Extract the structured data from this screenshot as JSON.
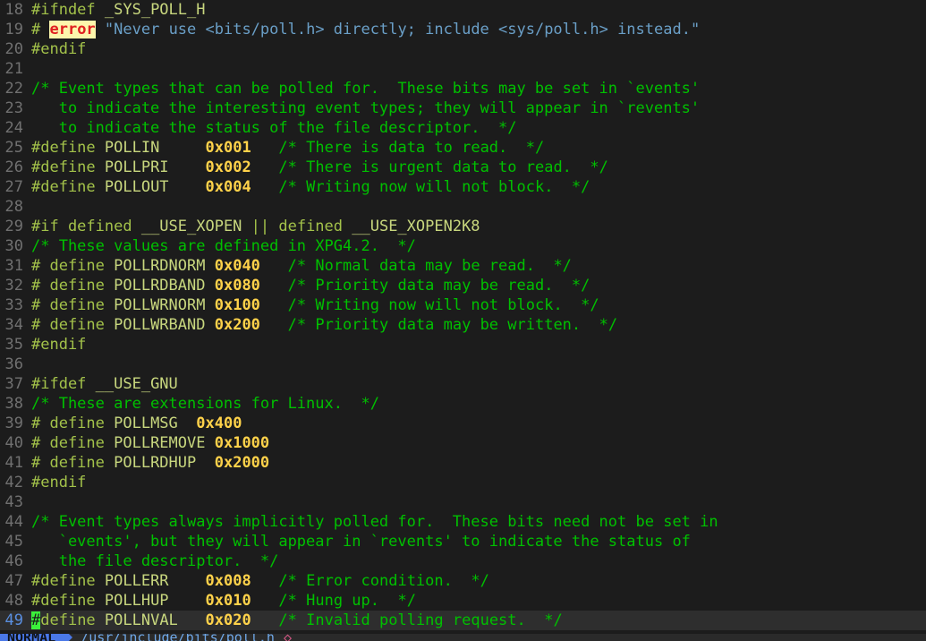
{
  "app": {
    "name": "vim-editor",
    "background": "#1c1c1c",
    "current_line": 49
  },
  "colors": {
    "background": "#1c1c1c",
    "current_line_background": "#2e2e2e",
    "line_number": "#707070",
    "current_line_number": "#5a8fe0",
    "preprocessor": "#a3c24a",
    "identifier": "#c8d77e",
    "number": "#ffd24a",
    "comment": "#00c000",
    "string": "#6a9fc7",
    "error_fg": "#e02020",
    "error_bg": "#fdf6ac",
    "cursor": "#3bf03b",
    "status_mode_bg": "#4a78e8",
    "status_file_fg": "#6fa8e8"
  },
  "statusline": {
    "mode": "NORMAL",
    "file": "/usr/include/bits/poll.h",
    "modified": "◇"
  },
  "lines": [
    {
      "num": "18",
      "current": false,
      "tokens": [
        {
          "t": "pre",
          "s": "#ifndef "
        },
        {
          "t": "ident",
          "s": "_SYS_POLL_H"
        }
      ]
    },
    {
      "num": "19",
      "current": false,
      "tokens": [
        {
          "t": "pre",
          "s": "# "
        },
        {
          "t": "err",
          "s": "error"
        },
        {
          "t": "plain",
          "s": " "
        },
        {
          "t": "str",
          "s": "\"Never use <bits/poll.h> directly; include <sys/poll.h> instead.\""
        }
      ]
    },
    {
      "num": "20",
      "current": false,
      "tokens": [
        {
          "t": "pre",
          "s": "#endif"
        }
      ]
    },
    {
      "num": "21",
      "current": false,
      "tokens": []
    },
    {
      "num": "22",
      "current": false,
      "tokens": [
        {
          "t": "cmt",
          "s": "/* Event types that can be polled for.  These bits may be set in `events'"
        }
      ]
    },
    {
      "num": "23",
      "current": false,
      "tokens": [
        {
          "t": "cmt",
          "s": "   to indicate the interesting event types; they will appear in `revents'"
        }
      ]
    },
    {
      "num": "24",
      "current": false,
      "tokens": [
        {
          "t": "cmt",
          "s": "   to indicate the status of the file descriptor.  */"
        }
      ]
    },
    {
      "num": "25",
      "current": false,
      "tokens": [
        {
          "t": "pre",
          "s": "#define "
        },
        {
          "t": "ident",
          "s": "POLLIN"
        },
        {
          "t": "plain",
          "s": "     "
        },
        {
          "t": "num",
          "s": "0x001"
        },
        {
          "t": "plain",
          "s": "   "
        },
        {
          "t": "cmt",
          "s": "/* There is data to read.  */"
        }
      ]
    },
    {
      "num": "26",
      "current": false,
      "tokens": [
        {
          "t": "pre",
          "s": "#define "
        },
        {
          "t": "ident",
          "s": "POLLPRI"
        },
        {
          "t": "plain",
          "s": "    "
        },
        {
          "t": "num",
          "s": "0x002"
        },
        {
          "t": "plain",
          "s": "   "
        },
        {
          "t": "cmt",
          "s": "/* There is urgent data to read.  */"
        }
      ]
    },
    {
      "num": "27",
      "current": false,
      "tokens": [
        {
          "t": "pre",
          "s": "#define "
        },
        {
          "t": "ident",
          "s": "POLLOUT"
        },
        {
          "t": "plain",
          "s": "    "
        },
        {
          "t": "num",
          "s": "0x004"
        },
        {
          "t": "plain",
          "s": "   "
        },
        {
          "t": "cmt",
          "s": "/* Writing now will not block.  */"
        }
      ]
    },
    {
      "num": "28",
      "current": false,
      "tokens": []
    },
    {
      "num": "29",
      "current": false,
      "tokens": [
        {
          "t": "pre",
          "s": "#if defined "
        },
        {
          "t": "ident",
          "s": "__USE_XOPEN"
        },
        {
          "t": "pre",
          "s": " || defined "
        },
        {
          "t": "ident",
          "s": "__USE_XOPEN2K8"
        }
      ]
    },
    {
      "num": "30",
      "current": false,
      "tokens": [
        {
          "t": "cmt",
          "s": "/* These values are defined in XPG4.2.  */"
        }
      ]
    },
    {
      "num": "31",
      "current": false,
      "tokens": [
        {
          "t": "pre",
          "s": "# define "
        },
        {
          "t": "ident",
          "s": "POLLRDNORM"
        },
        {
          "t": "plain",
          "s": " "
        },
        {
          "t": "num",
          "s": "0x040"
        },
        {
          "t": "plain",
          "s": "   "
        },
        {
          "t": "cmt",
          "s": "/* Normal data may be read.  */"
        }
      ]
    },
    {
      "num": "32",
      "current": false,
      "tokens": [
        {
          "t": "pre",
          "s": "# define "
        },
        {
          "t": "ident",
          "s": "POLLRDBAND"
        },
        {
          "t": "plain",
          "s": " "
        },
        {
          "t": "num",
          "s": "0x080"
        },
        {
          "t": "plain",
          "s": "   "
        },
        {
          "t": "cmt",
          "s": "/* Priority data may be read.  */"
        }
      ]
    },
    {
      "num": "33",
      "current": false,
      "tokens": [
        {
          "t": "pre",
          "s": "# define "
        },
        {
          "t": "ident",
          "s": "POLLWRNORM"
        },
        {
          "t": "plain",
          "s": " "
        },
        {
          "t": "num",
          "s": "0x100"
        },
        {
          "t": "plain",
          "s": "   "
        },
        {
          "t": "cmt",
          "s": "/* Writing now will not block.  */"
        }
      ]
    },
    {
      "num": "34",
      "current": false,
      "tokens": [
        {
          "t": "pre",
          "s": "# define "
        },
        {
          "t": "ident",
          "s": "POLLWRBAND"
        },
        {
          "t": "plain",
          "s": " "
        },
        {
          "t": "num",
          "s": "0x200"
        },
        {
          "t": "plain",
          "s": "   "
        },
        {
          "t": "cmt",
          "s": "/* Priority data may be written.  */"
        }
      ]
    },
    {
      "num": "35",
      "current": false,
      "tokens": [
        {
          "t": "pre",
          "s": "#endif"
        }
      ]
    },
    {
      "num": "36",
      "current": false,
      "tokens": []
    },
    {
      "num": "37",
      "current": false,
      "tokens": [
        {
          "t": "pre",
          "s": "#ifdef "
        },
        {
          "t": "ident",
          "s": "__USE_GNU"
        }
      ]
    },
    {
      "num": "38",
      "current": false,
      "tokens": [
        {
          "t": "cmt",
          "s": "/* These are extensions for Linux.  */"
        }
      ]
    },
    {
      "num": "39",
      "current": false,
      "tokens": [
        {
          "t": "pre",
          "s": "# define "
        },
        {
          "t": "ident",
          "s": "POLLMSG"
        },
        {
          "t": "plain",
          "s": "  "
        },
        {
          "t": "num",
          "s": "0x400"
        }
      ]
    },
    {
      "num": "40",
      "current": false,
      "tokens": [
        {
          "t": "pre",
          "s": "# define "
        },
        {
          "t": "ident",
          "s": "POLLREMOVE"
        },
        {
          "t": "plain",
          "s": " "
        },
        {
          "t": "num",
          "s": "0x1000"
        }
      ]
    },
    {
      "num": "41",
      "current": false,
      "tokens": [
        {
          "t": "pre",
          "s": "# define "
        },
        {
          "t": "ident",
          "s": "POLLRDHUP"
        },
        {
          "t": "plain",
          "s": "  "
        },
        {
          "t": "num",
          "s": "0x2000"
        }
      ]
    },
    {
      "num": "42",
      "current": false,
      "tokens": [
        {
          "t": "pre",
          "s": "#endif"
        }
      ]
    },
    {
      "num": "43",
      "current": false,
      "tokens": []
    },
    {
      "num": "44",
      "current": false,
      "tokens": [
        {
          "t": "cmt",
          "s": "/* Event types always implicitly polled for.  These bits need not be set in"
        }
      ]
    },
    {
      "num": "45",
      "current": false,
      "tokens": [
        {
          "t": "cmt",
          "s": "   `events', but they will appear in `revents' to indicate the status of"
        }
      ]
    },
    {
      "num": "46",
      "current": false,
      "tokens": [
        {
          "t": "cmt",
          "s": "   the file descriptor.  */"
        }
      ]
    },
    {
      "num": "47",
      "current": false,
      "tokens": [
        {
          "t": "pre",
          "s": "#define "
        },
        {
          "t": "ident",
          "s": "POLLERR"
        },
        {
          "t": "plain",
          "s": "    "
        },
        {
          "t": "num",
          "s": "0x008"
        },
        {
          "t": "plain",
          "s": "   "
        },
        {
          "t": "cmt",
          "s": "/* Error condition.  */"
        }
      ]
    },
    {
      "num": "48",
      "current": false,
      "tokens": [
        {
          "t": "pre",
          "s": "#define "
        },
        {
          "t": "ident",
          "s": "POLLHUP"
        },
        {
          "t": "plain",
          "s": "    "
        },
        {
          "t": "num",
          "s": "0x010"
        },
        {
          "t": "plain",
          "s": "   "
        },
        {
          "t": "cmt",
          "s": "/* Hung up.  */"
        }
      ]
    },
    {
      "num": "49",
      "current": true,
      "tokens": [
        {
          "t": "cursor",
          "s": "#"
        },
        {
          "t": "pre",
          "s": "define "
        },
        {
          "t": "ident",
          "s": "POLLNVAL"
        },
        {
          "t": "plain",
          "s": "   "
        },
        {
          "t": "num",
          "s": "0x020"
        },
        {
          "t": "plain",
          "s": "   "
        },
        {
          "t": "cmt",
          "s": "/* Invalid polling request.  */"
        }
      ]
    }
  ]
}
